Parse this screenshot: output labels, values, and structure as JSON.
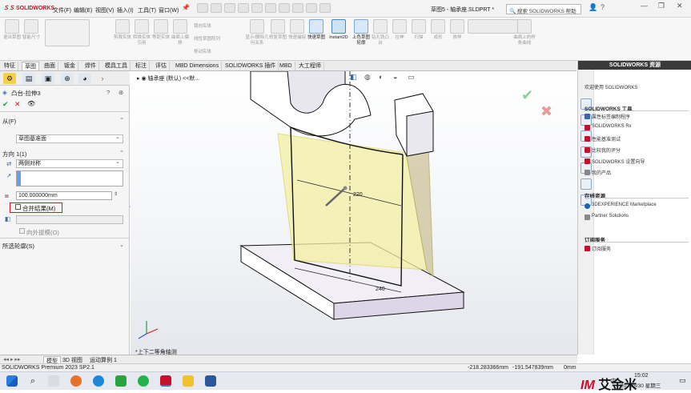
{
  "app": {
    "logo": "SOLIDWORKS",
    "document_title": "草图5 - 轴承座.SLDPRT *",
    "search_placeholder": "搜索 SOLIDWORKS 帮助"
  },
  "menu": [
    "文件(F)",
    "编辑(E)",
    "视图(V)",
    "插入(I)",
    "工具(T)",
    "窗口(W)"
  ],
  "ribbon": {
    "items": [
      "退出草图",
      "智能尺寸",
      "",
      "",
      "",
      "",
      "",
      "",
      "剪裁实体",
      "转换实体引用",
      "等距实体",
      "等距曲面",
      "镜向实体",
      "线性草图阵列",
      "移动实体",
      "显示/删除几何关系",
      "修复草图",
      "快速捕捉",
      "快速草图",
      "Instant2D",
      "上色草图轮廓",
      "",
      "",
      "",
      "",
      "",
      "",
      "",
      "",
      "",
      "",
      ""
    ],
    "right_items": [
      "",
      "拉伸凸台/基体",
      "旋转凸台/基体",
      "扫描",
      "放样凸台/基体",
      "边界凸台/基体",
      "拉伸切除",
      "异型孔向导",
      "旋转切除",
      "扫描切除",
      "放样切割",
      "边界切除",
      "圆角",
      "线性阵列",
      "筋",
      "拔模",
      "抽壳",
      "包覆",
      "相交",
      "镜向"
    ],
    "group1": [
      "镜向实体",
      "线性草图阵列",
      "移动实体"
    ],
    "right_labels": [
      "钻孔",
      "旋转",
      "拉伸",
      "扫描",
      "成形",
      "放样",
      "曲面上"
    ],
    "visible_labels": [
      "退出草图",
      "智能尺寸",
      "剪裁实体",
      "转换实体引用",
      "等距实体",
      "曲面上偏移",
      "镜向实体",
      "线性草图阵列",
      "移动实体",
      "显示/删除几何关系",
      "修复草图",
      "快速捕捉",
      "快速草图",
      "Instant2D",
      "上色草图轮廓",
      "钻孔铣凸台",
      "拉伸",
      "扫描",
      "成形",
      "放样",
      "曲面上的样条曲线"
    ]
  },
  "tabs": [
    "特征",
    "草图",
    "曲面",
    "钣金",
    "焊件",
    "模具工具",
    "标注",
    "评估",
    "MBD Dimensions",
    "SOLIDWORKS 插件",
    "MBD",
    "大工程师"
  ],
  "active_tab": "草图",
  "left_panel": {
    "feature_name": "凸台-拉伸3",
    "from_label": "从(F)",
    "from_value": "草图基准面",
    "direction_label": "方向 1(1)",
    "direction_value": "两侧对称",
    "depth_value": "100.000000mm",
    "merge_label": "合并结果(M)",
    "draft_outward": "向外拔模(O)",
    "contours_label": "所选轮廓(S)"
  },
  "canvas": {
    "breadcrumb": "轴承座 (默认) <<默...",
    "dim_top": "220",
    "dim_bottom": "240",
    "view_label": "*上下二等角轴测"
  },
  "right_panel": {
    "title": "SOLIDWORKS 资源",
    "welcome": "欢迎使用 SOLIDWORKS",
    "tools_header": "SOLIDWORKS 工具",
    "tools": [
      "属性标签编制程序",
      "SOLIDWORKS Rx",
      "性能基准测试",
      "比较我的评分",
      "SOLIDWORKS 设置向导",
      "我的产品"
    ],
    "online_header": "在线资源",
    "online": [
      "3DEXPERIENCE Marketplace",
      "Partner Solutions"
    ],
    "subs_header": "订阅服务",
    "subs": [
      "订阅服务"
    ]
  },
  "bottom_tabs": [
    "模型",
    "3D 视图",
    "运动算例 1"
  ],
  "status": {
    "product": "SOLIDWORKS Premium 2023 SP2.1",
    "coord_x": "-218.283366mm",
    "coord_y": "-191.547839mm",
    "coord_z": "0mm"
  },
  "taskbar": {
    "time": "15:02",
    "date": "2023/8/30 星期三",
    "ime": "中",
    "brand": "艾金米"
  },
  "colors": {
    "accent": "#c8102e",
    "solid_body": "#e8e6ef",
    "preview": "#f4f0a3"
  }
}
